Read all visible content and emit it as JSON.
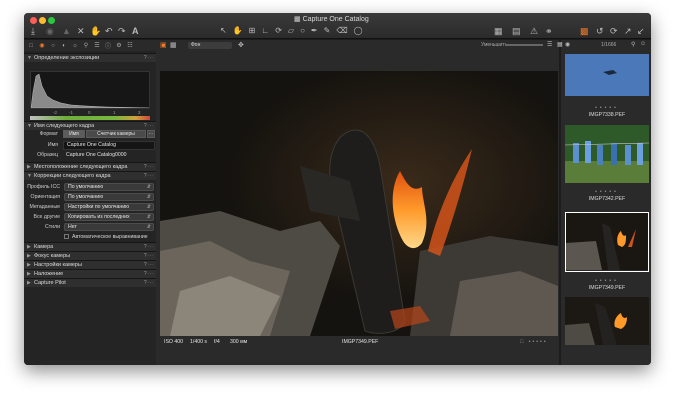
{
  "window": {
    "title": "Capture One Catalog",
    "title_icon": "catalog-icon"
  },
  "toolbar": {
    "left_icons": [
      "import-icon",
      "camera-icon",
      "delete-icon",
      "clear-icon",
      "undo-icon",
      "redo-icon",
      "text-icon"
    ],
    "cursor_tools": [
      "pointer-icon",
      "pan-icon",
      "crop-icon",
      "straighten-icon",
      "rotate-icon",
      "keystone-icon",
      "spot-icon",
      "picker-icon",
      "brush-icon",
      "erase-icon",
      "gradient-icon"
    ],
    "right_icons": [
      "grid-icon",
      "stack-icon",
      "warning-icon",
      "glasses-icon",
      "export-icon",
      "reset-icon",
      "refresh-icon",
      "forward-icon",
      "share-icon"
    ],
    "preset_select": "Фон",
    "zoom_label": "Уменьшить",
    "image_count": "1/1666"
  },
  "tool_tabs": [
    "library-tab",
    "capture-tab",
    "lens-tab",
    "color-tab",
    "exposure-tab",
    "details-tab",
    "adjust-tab",
    "metadata-tab",
    "output-tab",
    "batch-tab"
  ],
  "panel": {
    "exposure": {
      "title": "Определение экспозиции",
      "scale": [
        "-2",
        "-1",
        "0",
        "1",
        "2"
      ]
    },
    "naming": {
      "title": "Имя следующего кадра",
      "format_label": "Формат",
      "format_tokens": [
        "Имя",
        "Счетчик камеры"
      ],
      "name_label": "Имя",
      "name_value": "Capture One Catalog",
      "sample_label": "Образец",
      "sample_value": "Capture One Catalog0000"
    },
    "location": {
      "title": "Местоположение следующего кадра"
    },
    "adjustments": {
      "title": "Коррекции следующего кадра",
      "rows": [
        {
          "label": "Профиль ICC",
          "value": "По умолчанию"
        },
        {
          "label": "Ориентация",
          "value": "По умолчанию"
        },
        {
          "label": "Метаданные",
          "value": "Настройки по умолчанию"
        },
        {
          "label": "Все другие",
          "value": "Копировать из последних"
        },
        {
          "label": "Стили",
          "value": "Нет"
        }
      ],
      "auto_align": "Автоматическое выравнивание"
    },
    "collapsed": [
      "Камера",
      "Фокус камеры",
      "Настройки камеры",
      "Наложение",
      "Capture Pilot"
    ]
  },
  "viewer": {
    "iso": "ISO 400",
    "shutter": "1/400 s",
    "aperture": "f/4",
    "focal": "300 мм",
    "filename": "IMGP7349.PEF"
  },
  "browser": {
    "thumbnails": [
      {
        "caption": "IMGP7338.PEF"
      },
      {
        "caption": "IMGP7342.PEF"
      },
      {
        "caption": "IMGP7349.PEF"
      }
    ]
  },
  "colors": {
    "accent": "#f07a2a",
    "panel": "#242424",
    "selected_border": "#ffffff"
  }
}
